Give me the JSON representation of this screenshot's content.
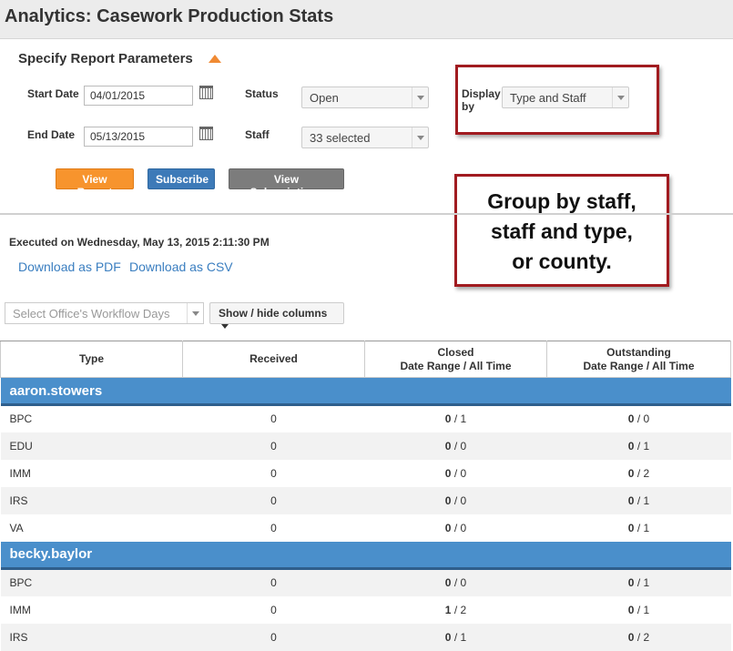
{
  "header": {
    "title": "Analytics: Casework Production Stats"
  },
  "params": {
    "title": "Specify Report Parameters",
    "start_date_label": "Start Date",
    "start_date": "04/01/2015",
    "end_date_label": "End Date",
    "end_date": "05/13/2015",
    "status_label": "Status",
    "status_value": "Open",
    "staff_label": "Staff",
    "staff_value": "33 selected",
    "display_by_label_1": "Display",
    "display_by_label_2": "by",
    "display_by_value": "Type and Staff",
    "buttons": {
      "view_report": "View Report",
      "subscribe": "Subscribe",
      "view_subscriptions": "View Subscriptions"
    }
  },
  "callout": {
    "lines": [
      "Group by staff,",
      "staff and type,",
      "or county."
    ]
  },
  "results": {
    "executed": "Executed on Wednesday, May 13, 2015 2:11:30 PM",
    "download_pdf": "Download as PDF",
    "download_csv": "Download as CSV",
    "workflow_placeholder": "Select Office's Workflow Days",
    "columns_button": "Show / hide columns"
  },
  "table": {
    "headers": {
      "type": "Type",
      "received": "Received",
      "closed_1": "Closed",
      "closed_2": "Date Range / All Time",
      "outstanding_1": "Outstanding",
      "outstanding_2": "Date Range / All Time"
    },
    "groups": [
      {
        "name": "aaron.stowers",
        "rows": [
          {
            "type": "BPC",
            "received": "0",
            "closed_range": "0",
            "closed_all": "1",
            "out_range": "0",
            "out_all": "0"
          },
          {
            "type": "EDU",
            "received": "0",
            "closed_range": "0",
            "closed_all": "0",
            "out_range": "0",
            "out_all": "1"
          },
          {
            "type": "IMM",
            "received": "0",
            "closed_range": "0",
            "closed_all": "0",
            "out_range": "0",
            "out_all": "2"
          },
          {
            "type": "IRS",
            "received": "0",
            "closed_range": "0",
            "closed_all": "0",
            "out_range": "0",
            "out_all": "1"
          },
          {
            "type": "VA",
            "received": "0",
            "closed_range": "0",
            "closed_all": "0",
            "out_range": "0",
            "out_all": "1"
          }
        ]
      },
      {
        "name": "becky.baylor",
        "rows": [
          {
            "type": "BPC",
            "received": "0",
            "closed_range": "0",
            "closed_all": "0",
            "out_range": "0",
            "out_all": "1"
          },
          {
            "type": "IMM",
            "received": "0",
            "closed_range": "1",
            "closed_all": "2",
            "out_range": "0",
            "out_all": "1"
          },
          {
            "type": "IRS",
            "received": "0",
            "closed_range": "0",
            "closed_all": "1",
            "out_range": "0",
            "out_all": "2"
          }
        ]
      }
    ]
  },
  "colors": {
    "group_header": "#4a8fcb",
    "callout_border": "#a11b20",
    "accent_orange": "#f7942d",
    "link": "#3a7ec0"
  }
}
